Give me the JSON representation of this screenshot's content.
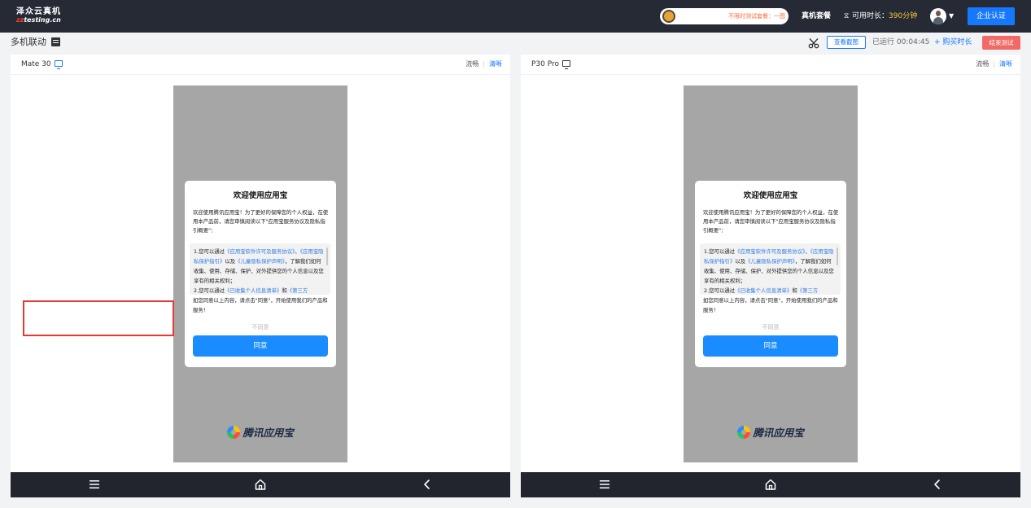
{
  "app": {
    "logo_line1": "泽众云真机",
    "logo_line2_prefix": "zz",
    "logo_line2_suffix": "testing.cn"
  },
  "topbar": {
    "notice": "不限时测试套餐：一图",
    "package_label": "真机套餐",
    "time_label": "可用时长：",
    "time_value": "390分钟",
    "enterprise_btn": "企业认证"
  },
  "subheader": {
    "title": "多机联动",
    "screenshot_btn": "查看截图",
    "runtime_label": "已运行",
    "runtime_value": "00:04:45",
    "buy_label": "+ 购买时长",
    "end_btn": "结束测试"
  },
  "devices": [
    {
      "name": "Mate 30",
      "quality_smooth": "流畅",
      "quality_hd": "清晰",
      "dialog": {
        "title": "欢迎使用应用宝",
        "intro": "欢迎使用腾讯应用宝！为了更好的保障您的个人权益，在使用本产品前，请您审慎阅读以下\"应用宝服务协议及隐私指引概要\"：",
        "terms_1_prefix": "1.您可以通过",
        "terms_1_link1": "《应用宝软件许可及服务协议》",
        "terms_1_sep": "、",
        "terms_1_link2": "《应用宝隐私保护指引》",
        "terms_1_and": "以及",
        "terms_1_link3": "《儿童隐私保护声明》",
        "terms_1_suffix": "，了解我们如何收集、使用、存储、保护、对外提供您的个人信息以及您享有的相关权利；",
        "terms_2_prefix": "2.您可以通过",
        "terms_2_link1": "《已收集个人信息清单》",
        "terms_2_and": "和",
        "terms_2_link2": "《第三方",
        "agree_text": "如您同意以上内容，请点击\"同意\"，开始使用我们的产品和服务！",
        "disagree": "不同意",
        "agree_btn": "同意"
      },
      "brand": "腾讯应用宝"
    },
    {
      "name": "P30 Pro",
      "quality_smooth": "流畅",
      "quality_hd": "清晰",
      "dialog": {
        "title": "欢迎使用应用宝",
        "intro": "欢迎使用腾讯应用宝！为了更好的保障您的个人权益，在使用本产品前，请您审慎阅读以下\"应用宝服务协议及隐私指引概要\"：",
        "terms_1_prefix": "1.您可以通过",
        "terms_1_link1": "《应用宝软件许可及服务协议》",
        "terms_1_sep": "、",
        "terms_1_link2": "《应用宝隐私保护指引》",
        "terms_1_and": "以及",
        "terms_1_link3": "《儿童隐私保护声明》",
        "terms_1_suffix": "，了解我们如何收集、使用、存储、保护、对外提供您的个人信息以及您享有的相关权利；",
        "terms_2_prefix": "2.您可以通过",
        "terms_2_link1": "《已收集个人信息清单》",
        "terms_2_and": "和",
        "terms_2_link2": "《第三方",
        "agree_text": "如您同意以上内容，请点击\"同意\"，开始使用我们的产品和服务！",
        "disagree": "不同意",
        "agree_btn": "同意"
      },
      "brand": "腾讯应用宝"
    }
  ],
  "icons": {
    "collapse": "collapse-icon",
    "scissors": "scissors-icon",
    "hourglass": "hourglass-icon",
    "monitor": "monitor-icon",
    "menu": "menu-icon",
    "home": "home-icon",
    "back": "back-icon"
  },
  "colors": {
    "topbar_bg": "#262a35",
    "accent": "#1677ff",
    "time_value": "#f7c83a",
    "end_btn": "#f06a66",
    "agree_btn": "#1a8cff",
    "highlight": "#e53935"
  }
}
